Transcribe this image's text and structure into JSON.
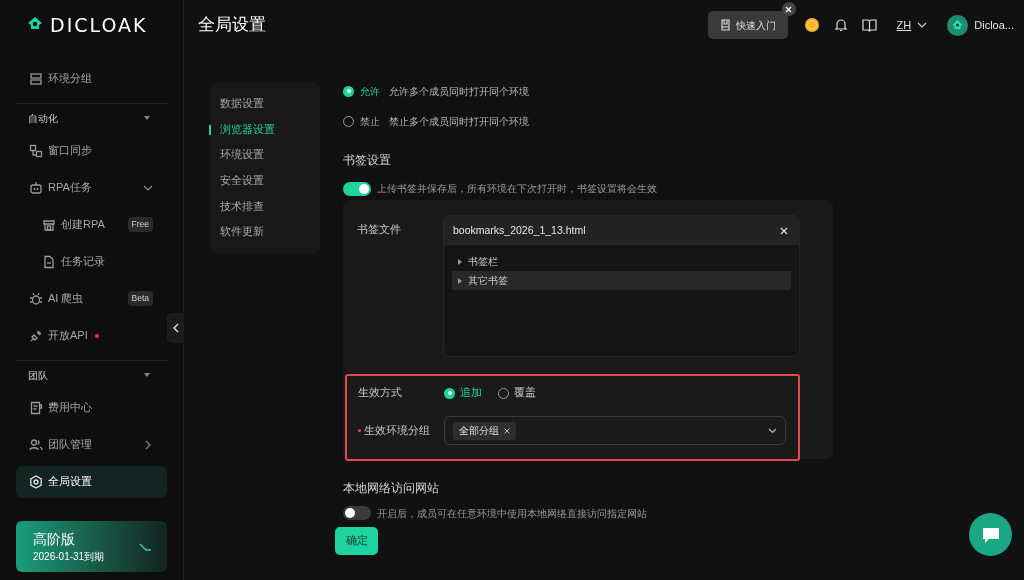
{
  "sidebar": {
    "logo": "DICLOAK",
    "items": [
      {
        "kind": "item",
        "label": "环境分组",
        "selected": false
      },
      {
        "kind": "section",
        "label": "自动化",
        "expanded": true
      },
      {
        "kind": "item",
        "label": "窗口同步",
        "selected": false
      },
      {
        "kind": "item",
        "label": "RPA任务",
        "selected": false,
        "expanded": true
      },
      {
        "kind": "subitem",
        "label": "创建RPA",
        "selected": false,
        "badge": "Free"
      },
      {
        "kind": "subitem",
        "label": "任务记录",
        "selected": false
      },
      {
        "kind": "item",
        "label": "AI 爬虫",
        "selected": false,
        "badge": "Beta"
      },
      {
        "kind": "item",
        "label": "开放API",
        "selected": false,
        "dot": true
      },
      {
        "kind": "section",
        "label": "团队",
        "expanded": true
      },
      {
        "kind": "item",
        "label": "费用中心",
        "selected": false
      },
      {
        "kind": "item",
        "label": "团队管理",
        "selected": false,
        "expanded": false
      },
      {
        "kind": "item",
        "label": "全局设置",
        "selected": true
      }
    ],
    "plan": {
      "name": "高阶版",
      "expiry": "2026-01-31到期"
    }
  },
  "header": {
    "title": "全局设置",
    "quick_start": "快速入门",
    "language": "ZH",
    "user": "Dicloa..."
  },
  "settings_menu": [
    {
      "label": "数据设置",
      "selected": false
    },
    {
      "label": "浏览器设置",
      "selected": true
    },
    {
      "label": "环境设置",
      "selected": false
    },
    {
      "label": "安全设置",
      "selected": false
    },
    {
      "label": "技术排查",
      "selected": false
    },
    {
      "label": "软件更新",
      "selected": false
    }
  ],
  "concurrent_access": [
    {
      "label": "允许",
      "description": "允许多个成员同时打开同个环境",
      "selected": true
    },
    {
      "label": "禁止",
      "description": "禁止多个成员同时打开同个环境",
      "selected": false
    }
  ],
  "bookmarks": {
    "title": "书签设置",
    "on": true,
    "hint": "上传书签并保存后，所有环境在下次打开时，书签设置将会生效",
    "file_label": "书签文件",
    "file_name": "bookmarks_2026_1_13.html",
    "tree": [
      {
        "label": "书签栏",
        "selected": false
      },
      {
        "label": "其它书签",
        "selected": true
      }
    ],
    "mode_label": "生效方式",
    "modes": [
      {
        "label": "追加",
        "selected": true
      },
      {
        "label": "覆盖",
        "selected": false
      }
    ],
    "group_label": "生效环境分组",
    "group_required": true,
    "groups": [
      "全部分组"
    ]
  },
  "local_network": {
    "title": "本地网络访问网站",
    "on": false,
    "hint": "开启后，成员可在任意环境中使用本地网络直接访问指定网站"
  },
  "confirm": "确定"
}
